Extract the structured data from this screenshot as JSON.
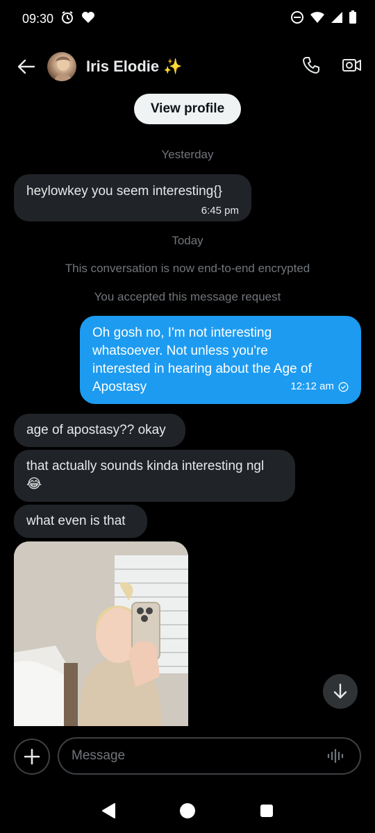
{
  "status_bar": {
    "time": "09:30",
    "left_icons": [
      "alarm-icon",
      "heart-icon"
    ],
    "right_icons": [
      "dnd-icon",
      "wifi-icon",
      "signal-icon",
      "battery-icon"
    ]
  },
  "header": {
    "back_icon": "arrow-left-icon",
    "contact_name": "Iris Elodie ✨",
    "actions": [
      "phone-icon",
      "video-icon"
    ]
  },
  "view_profile_label": "View profile",
  "conversation": {
    "yesterday_label": "Yesterday",
    "msg1": {
      "text": "heylowkey you seem interesting{}",
      "time": "6:45 pm"
    },
    "today_label": "Today",
    "encrypted_notice": "This conversation is now end-to-end encrypted",
    "accepted_notice": "You accepted this message request",
    "msg2": {
      "text": "Oh gosh no, I'm not interesting whatsoever. Not unless you're interested in hearing about the Age of Apostasy",
      "time": "12:12 am",
      "status_icon": "check-circle-icon"
    },
    "msg3": {
      "text": "age of apostasy?? okay"
    },
    "msg4": {
      "text": "that actually sounds kinda interesting ngl 😂"
    },
    "msg5": {
      "text": "what even is that"
    }
  },
  "composer": {
    "placeholder": "Message",
    "add_icon": "plus-icon",
    "voice_icon": "waveform-icon"
  },
  "colors": {
    "background": "#000000",
    "incoming_bubble": "#202327",
    "outgoing_bubble": "#1d9bf0",
    "muted_text": "#71767b"
  }
}
